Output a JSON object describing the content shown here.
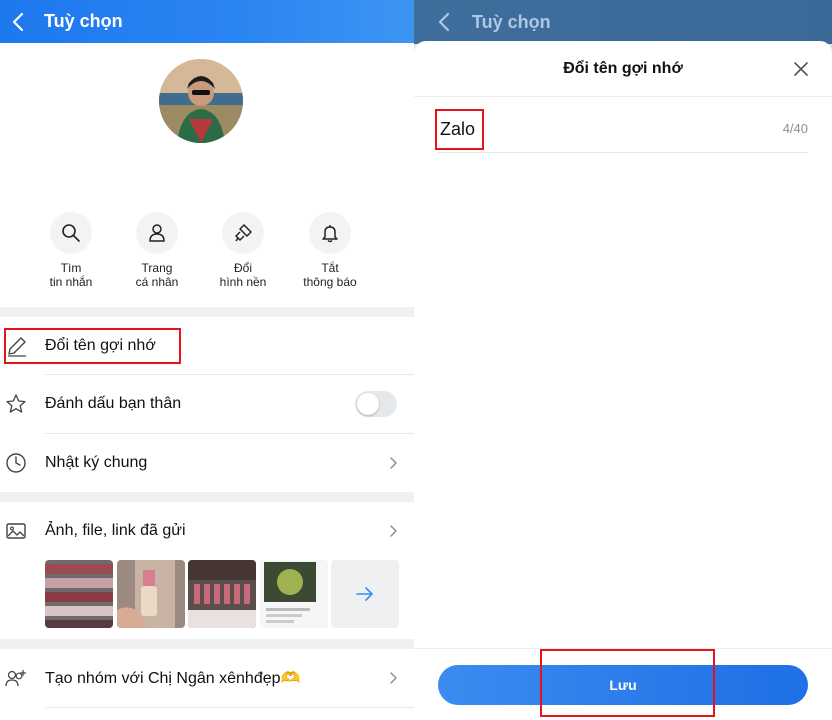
{
  "left": {
    "header": {
      "title": "Tuỳ chọn"
    },
    "quick_actions": [
      {
        "label": "Tìm\ntin nhắn",
        "icon": "search-icon"
      },
      {
        "label": "Trang\ncá nhân",
        "icon": "user-icon"
      },
      {
        "label": "Đổi\nhình nền",
        "icon": "brush-icon"
      },
      {
        "label": "Tắt\nthông báo",
        "icon": "bell-icon"
      }
    ],
    "menu": {
      "rename": "Đổi tên gợi nhớ",
      "best_friend": "Đánh dấu bạn thân",
      "best_friend_toggle": "off",
      "diary": "Nhật ký chung",
      "media": "Ảnh, file, link đã gửi",
      "create_group": "Tạo nhóm với Chị Ngân xênhđẹp🫶"
    }
  },
  "right": {
    "header": {
      "title": "Tuỳ chọn"
    },
    "sheet": {
      "title": "Đổi tên gợi nhớ",
      "input_value": "Zalo",
      "counter": "4/40",
      "save_label": "Lưu"
    }
  },
  "colors": {
    "header_blue": "#1e78ee",
    "accent_red_box": "#e3141b",
    "save_button": "#2a7eee"
  }
}
